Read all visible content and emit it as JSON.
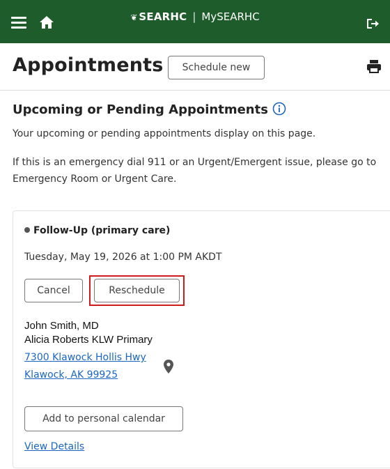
{
  "topbar": {
    "brand_name": "SEARHC",
    "app_name": "MySEARHC",
    "icons": {
      "menu": "hamburger-menu-icon",
      "home": "home-icon",
      "logout": "logout-icon"
    },
    "background": "#1f5c2b"
  },
  "header": {
    "title": "Appointments",
    "schedule_new_label": "Schedule new",
    "print_icon": "printer-icon"
  },
  "section": {
    "title": "Upcoming or Pending Appointments",
    "intro": "Your upcoming or pending appointments display on this page.",
    "emergency_notice": "If this is an emergency dial 911 or an Urgent/Emergent issue, please go to Emergency Room or Urgent Care."
  },
  "appointment": {
    "type": "Follow-Up (primary care)",
    "datetime": "Tuesday, May 19, 2026 at 1:00 PM AKDT",
    "cancel_label": "Cancel",
    "reschedule_label": "Reschedule",
    "provider": "John Smith, MD",
    "location_name": "Alicia Roberts KLW Primary",
    "address_line1": "7300 Klawock Hollis Hwy",
    "address_line2": "Klawock, AK 99925",
    "add_calendar_label": "Add to personal calendar",
    "view_details_label": "View Details"
  },
  "colors": {
    "link": "#1a66c2",
    "highlight": "#d11a1a"
  }
}
